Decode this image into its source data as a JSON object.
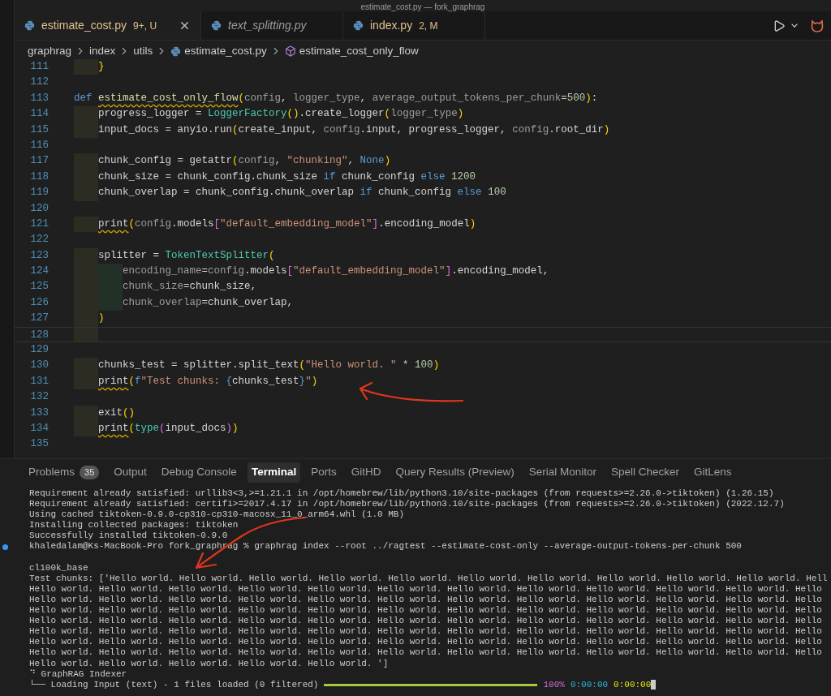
{
  "window": {
    "title": "estimate_cost.py — fork_graphrag"
  },
  "tabs": [
    {
      "label": "estimate_cost.py",
      "badge": "9+, U",
      "selected": true,
      "modified": true,
      "preview": false
    },
    {
      "label": "text_splitting.py",
      "selected": false,
      "modified": false,
      "preview": true
    },
    {
      "label": "index.py",
      "badge": "2, M",
      "selected": false,
      "modified": true,
      "preview": false
    }
  ],
  "breadcrumbs": [
    {
      "kind": "folder",
      "label": "graphrag"
    },
    {
      "kind": "folder",
      "label": "index"
    },
    {
      "kind": "folder",
      "label": "utils"
    },
    {
      "kind": "file",
      "label": "estimate_cost.py"
    },
    {
      "kind": "symbol",
      "label": "estimate_cost_only_flow"
    }
  ],
  "code": [
    {
      "number": "111",
      "tokens": [
        {
          "kind": "paren",
          "text": "    }"
        }
      ]
    },
    {
      "number": "112"
    },
    {
      "number": "113",
      "tokens": [
        {
          "kind": "keyword",
          "text": "def "
        },
        {
          "kind": "function",
          "text": "estimate_cost_only_flow",
          "warning": true
        },
        {
          "kind": "paren",
          "text": "("
        },
        {
          "kind": "param",
          "text": "config"
        },
        {
          "kind": "plain",
          "text": ", "
        },
        {
          "kind": "param",
          "text": "logger_type"
        },
        {
          "kind": "plain",
          "text": ", "
        },
        {
          "kind": "param",
          "text": "average_output_tokens_per_chunk"
        },
        {
          "kind": "plain",
          "text": "="
        },
        {
          "kind": "number",
          "text": "500"
        },
        {
          "kind": "paren",
          "text": ")"
        },
        {
          "kind": "plain",
          "text": ":"
        }
      ]
    },
    {
      "number": "114",
      "tokens": [
        {
          "kind": "plain",
          "text": "    progress_logger = "
        },
        {
          "kind": "class",
          "text": "LoggerFactory"
        },
        {
          "kind": "paren",
          "text": "()"
        },
        {
          "kind": "plain",
          "text": ".create_logger"
        },
        {
          "kind": "paren",
          "text": "("
        },
        {
          "kind": "param",
          "text": "logger_type"
        },
        {
          "kind": "paren",
          "text": ")"
        }
      ]
    },
    {
      "number": "115",
      "tokens": [
        {
          "kind": "plain",
          "text": "    input_docs = anyio.run"
        },
        {
          "kind": "paren",
          "text": "("
        },
        {
          "kind": "plain",
          "text": "create_input, "
        },
        {
          "kind": "param",
          "text": "config"
        },
        {
          "kind": "plain",
          "text": ".input, progress_logger, "
        },
        {
          "kind": "param",
          "text": "config"
        },
        {
          "kind": "plain",
          "text": ".root_dir"
        },
        {
          "kind": "paren",
          "text": ")"
        }
      ]
    },
    {
      "number": "116"
    },
    {
      "number": "117",
      "tokens": [
        {
          "kind": "plain",
          "text": "    chunk_config = getattr"
        },
        {
          "kind": "paren",
          "text": "("
        },
        {
          "kind": "param",
          "text": "config"
        },
        {
          "kind": "plain",
          "text": ", "
        },
        {
          "kind": "string",
          "text": "\"chunking\""
        },
        {
          "kind": "plain",
          "text": ", "
        },
        {
          "kind": "keyword",
          "text": "None"
        },
        {
          "kind": "paren",
          "text": ")"
        }
      ]
    },
    {
      "number": "118",
      "tokens": [
        {
          "kind": "plain",
          "text": "    chunk_size = chunk_config.chunk_size "
        },
        {
          "kind": "keyword",
          "text": "if"
        },
        {
          "kind": "plain",
          "text": " chunk_config "
        },
        {
          "kind": "keyword",
          "text": "else "
        },
        {
          "kind": "number",
          "text": "1200"
        }
      ]
    },
    {
      "number": "119",
      "tokens": [
        {
          "kind": "plain",
          "text": "    chunk_overlap = chunk_config.chunk_overlap "
        },
        {
          "kind": "keyword",
          "text": "if"
        },
        {
          "kind": "plain",
          "text": " chunk_config "
        },
        {
          "kind": "keyword",
          "text": "else "
        },
        {
          "kind": "number",
          "text": "100"
        }
      ]
    },
    {
      "number": "120"
    },
    {
      "number": "121",
      "tokens": [
        {
          "kind": "plain",
          "text": "    print",
          "warning": true
        },
        {
          "kind": "paren",
          "text": "("
        },
        {
          "kind": "param",
          "text": "config"
        },
        {
          "kind": "plain",
          "text": ".models"
        },
        {
          "kind": "bracket",
          "text": "["
        },
        {
          "kind": "string",
          "text": "\"default_embedding_model\""
        },
        {
          "kind": "bracket",
          "text": "]"
        },
        {
          "kind": "plain",
          "text": ".encoding_model"
        },
        {
          "kind": "paren",
          "text": ")"
        }
      ]
    },
    {
      "number": "122"
    },
    {
      "number": "123",
      "tokens": [
        {
          "kind": "plain",
          "text": "    splitter = "
        },
        {
          "kind": "class",
          "text": "TokenTextSplitter"
        },
        {
          "kind": "paren",
          "text": "("
        }
      ]
    },
    {
      "number": "124",
      "tokens": [
        {
          "kind": "param",
          "text": "        encoding_name"
        },
        {
          "kind": "plain",
          "text": "="
        },
        {
          "kind": "param",
          "text": "config"
        },
        {
          "kind": "plain",
          "text": ".models"
        },
        {
          "kind": "bracket",
          "text": "["
        },
        {
          "kind": "string",
          "text": "\"default_embedding_model\""
        },
        {
          "kind": "bracket",
          "text": "]"
        },
        {
          "kind": "plain",
          "text": ".encoding_model,"
        }
      ]
    },
    {
      "number": "125",
      "tokens": [
        {
          "kind": "param",
          "text": "        chunk_size"
        },
        {
          "kind": "plain",
          "text": "=chunk_size,"
        }
      ]
    },
    {
      "number": "126",
      "tokens": [
        {
          "kind": "param",
          "text": "        chunk_overlap"
        },
        {
          "kind": "plain",
          "text": "=chunk_overlap,"
        }
      ]
    },
    {
      "number": "127",
      "tokens": [
        {
          "kind": "paren",
          "text": "    )"
        }
      ]
    },
    {
      "number": "128",
      "current": true
    },
    {
      "number": "129"
    },
    {
      "number": "130",
      "tokens": [
        {
          "kind": "plain",
          "text": "    chunks_test = splitter.split_text"
        },
        {
          "kind": "paren",
          "text": "("
        },
        {
          "kind": "string",
          "text": "\"Hello world. \""
        },
        {
          "kind": "plain",
          "text": " * "
        },
        {
          "kind": "number",
          "text": "100"
        },
        {
          "kind": "paren",
          "text": ")"
        }
      ]
    },
    {
      "number": "131",
      "tokens": [
        {
          "kind": "plain",
          "text": "    print",
          "warning": true
        },
        {
          "kind": "paren",
          "text": "("
        },
        {
          "kind": "keyword",
          "text": "f"
        },
        {
          "kind": "string",
          "text": "\"Test chunks: "
        },
        {
          "kind": "keyword",
          "text": "{"
        },
        {
          "kind": "plain",
          "text": "chunks_test"
        },
        {
          "kind": "keyword",
          "text": "}"
        },
        {
          "kind": "string",
          "text": "\""
        },
        {
          "kind": "paren",
          "text": ")"
        }
      ]
    },
    {
      "number": "132"
    },
    {
      "number": "133",
      "tokens": [
        {
          "kind": "plain",
          "text": "    exit"
        },
        {
          "kind": "paren",
          "text": "()"
        }
      ]
    },
    {
      "number": "134",
      "tokens": [
        {
          "kind": "plain",
          "text": "    print",
          "warning": true
        },
        {
          "kind": "paren",
          "text": "("
        },
        {
          "kind": "class",
          "text": "type"
        },
        {
          "kind": "bracket",
          "text": "("
        },
        {
          "kind": "plain",
          "text": "input_docs"
        },
        {
          "kind": "bracket",
          "text": ")"
        },
        {
          "kind": "paren",
          "text": ")"
        }
      ]
    },
    {
      "number": "135"
    }
  ],
  "panel_tabs": [
    {
      "label": "Problems",
      "badge": "35",
      "selected": false
    },
    {
      "label": "Output",
      "selected": false
    },
    {
      "label": "Debug Console",
      "selected": false
    },
    {
      "label": "Terminal",
      "selected": true
    },
    {
      "label": "Ports",
      "selected": false
    },
    {
      "label": "GitHD",
      "selected": false
    },
    {
      "label": "Query Results (Preview)",
      "selected": false
    },
    {
      "label": "Serial Monitor",
      "selected": false
    },
    {
      "label": "Spell Checker",
      "selected": false
    },
    {
      "label": "GitLens",
      "selected": false
    }
  ],
  "terminal": [
    {
      "kind": "plain",
      "text": "Requirement already satisfied: urllib3<3,>=1.21.1 in /opt/homebrew/lib/python3.10/site-packages (from requests>=2.26.0->tiktoken) (1.26.15)"
    },
    {
      "kind": "plain",
      "text": "Requirement already satisfied: certifi>=2017.4.17 in /opt/homebrew/lib/python3.10/site-packages (from requests>=2.26.0->tiktoken) (2022.12.7)"
    },
    {
      "kind": "plain",
      "text": "Using cached tiktoken-0.9.0-cp310-cp310-macosx_11_0_arm64.whl (1.0 MB)"
    },
    {
      "kind": "plain",
      "text": "Installing collected packages: tiktoken"
    },
    {
      "kind": "plain",
      "text": "Successfully installed tiktoken-0.9.0"
    },
    {
      "kind": "prompt",
      "text": "khaledalam@Ks-MacBook-Pro fork_graphrag % graphrag index --root ../ragtest --estimate-cost-only --average-output-tokens-per-chunk 500"
    },
    {
      "kind": "blank"
    },
    {
      "kind": "plain",
      "text": "cl100k_base"
    },
    {
      "kind": "plain",
      "text": "Test chunks: ['Hello world. Hello world. Hello world. Hello world. Hello world. Hello world. Hello world. Hello world. Hello world. Hello world. Hell"
    },
    {
      "kind": "plain",
      "text": "Hello world. Hello world. Hello world. Hello world. Hello world. Hello world. Hello world. Hello world. Hello world. Hello world. Hello world. Hello"
    },
    {
      "kind": "plain",
      "text": "Hello world. Hello world. Hello world. Hello world. Hello world. Hello world. Hello world. Hello world. Hello world. Hello world. Hello world. Hello"
    },
    {
      "kind": "plain",
      "text": "Hello world. Hello world. Hello world. Hello world. Hello world. Hello world. Hello world. Hello world. Hello world. Hello world. Hello world. Hello"
    },
    {
      "kind": "plain",
      "text": "Hello world. Hello world. Hello world. Hello world. Hello world. Hello world. Hello world. Hello world. Hello world. Hello world. Hello world. Hello"
    },
    {
      "kind": "plain",
      "text": "Hello world. Hello world. Hello world. Hello world. Hello world. Hello world. Hello world. Hello world. Hello world. Hello world. Hello world. Hello"
    },
    {
      "kind": "plain",
      "text": "Hello world. Hello world. Hello world. Hello world. Hello world. Hello world. Hello world. Hello world. Hello world. Hello world. Hello world. Hello"
    },
    {
      "kind": "plain",
      "text": "Hello world. Hello world. Hello world. Hello world. Hello world. Hello world. Hello world. Hello world. Hello world. Hello world. Hello world. Hello"
    },
    {
      "kind": "plain",
      "text": "Hello world. Hello world. Hello world. Hello world. Hello world. ']"
    },
    {
      "kind": "plain",
      "text": "⠙ GraphRAG Indexer"
    },
    {
      "kind": "progress",
      "text": "└── Loading Input (text) - 1 files loaded (0 filtered)",
      "level": 1,
      "percent": "100%",
      "elapsed": "0:00:00",
      "remaining": "0:00:00"
    }
  ]
}
